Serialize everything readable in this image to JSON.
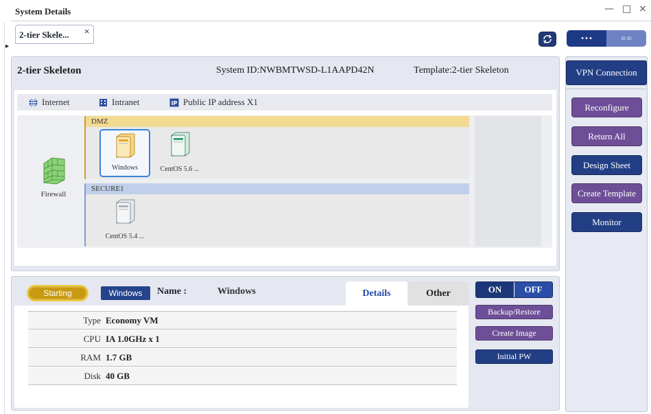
{
  "window": {
    "title": "System Details",
    "minimize": "—",
    "maximize": "□",
    "close": "×"
  },
  "doc_tab": {
    "label": "2-tier Skele...",
    "close": "×"
  },
  "view_toggle": {
    "left": "•••",
    "right": "≡≡"
  },
  "system": {
    "name": "2-tier Skeleton",
    "system_id": "System ID:NWBMTWSD-L1AAPD42N",
    "template": "Template:2-tier Skeleton"
  },
  "networks": [
    {
      "icon": "globe-icon",
      "label": "Internet"
    },
    {
      "icon": "building-icon",
      "label": "Intranet"
    },
    {
      "icon": "ip-icon",
      "label": "Public IP address X1"
    }
  ],
  "firewall": {
    "label": "Firewall"
  },
  "zones": {
    "dmz": {
      "label": "DMZ",
      "servers": [
        {
          "label": "Windows",
          "color": "#e9a825",
          "selected": true
        },
        {
          "label": "CentOS 5.6 ...",
          "color": "#2ea46e",
          "selected": false
        }
      ]
    },
    "secure1": {
      "label": "SECURE1",
      "servers": [
        {
          "label": "CentOS 5.4 ...",
          "color": "#a9b1bd",
          "selected": false
        }
      ]
    }
  },
  "sidebar": {
    "vpn": "VPN Connection",
    "buttons": [
      {
        "label": "Reconfigure",
        "style": "purple"
      },
      {
        "label": "Return All",
        "style": "purple"
      },
      {
        "label": "Design Sheet",
        "style": "blue"
      },
      {
        "label": "Create Template",
        "style": "purple"
      },
      {
        "label": "Monitor",
        "style": "blue"
      }
    ]
  },
  "server_detail": {
    "status": "Starting",
    "os": "Windows",
    "name_label": "Name :",
    "name_value": "Windows",
    "tabs": {
      "details": "Details",
      "other": "Other"
    },
    "rows": [
      {
        "key": "Type",
        "value": "Economy VM"
      },
      {
        "key": "CPU",
        "value": "IA 1.0GHz x 1"
      },
      {
        "key": "RAM",
        "value": "1.7 GB"
      },
      {
        "key": "Disk",
        "value": "40 GB"
      }
    ],
    "power": {
      "on": "ON",
      "off": "OFF"
    },
    "actions": {
      "backup": "Backup/Restore",
      "create_image": "Create Image",
      "initial_pw": "Initial PW"
    }
  },
  "colors": {
    "accent_blue": "#223f85",
    "accent_purple": "#6e4f97",
    "status_gold": "#c79a11"
  }
}
